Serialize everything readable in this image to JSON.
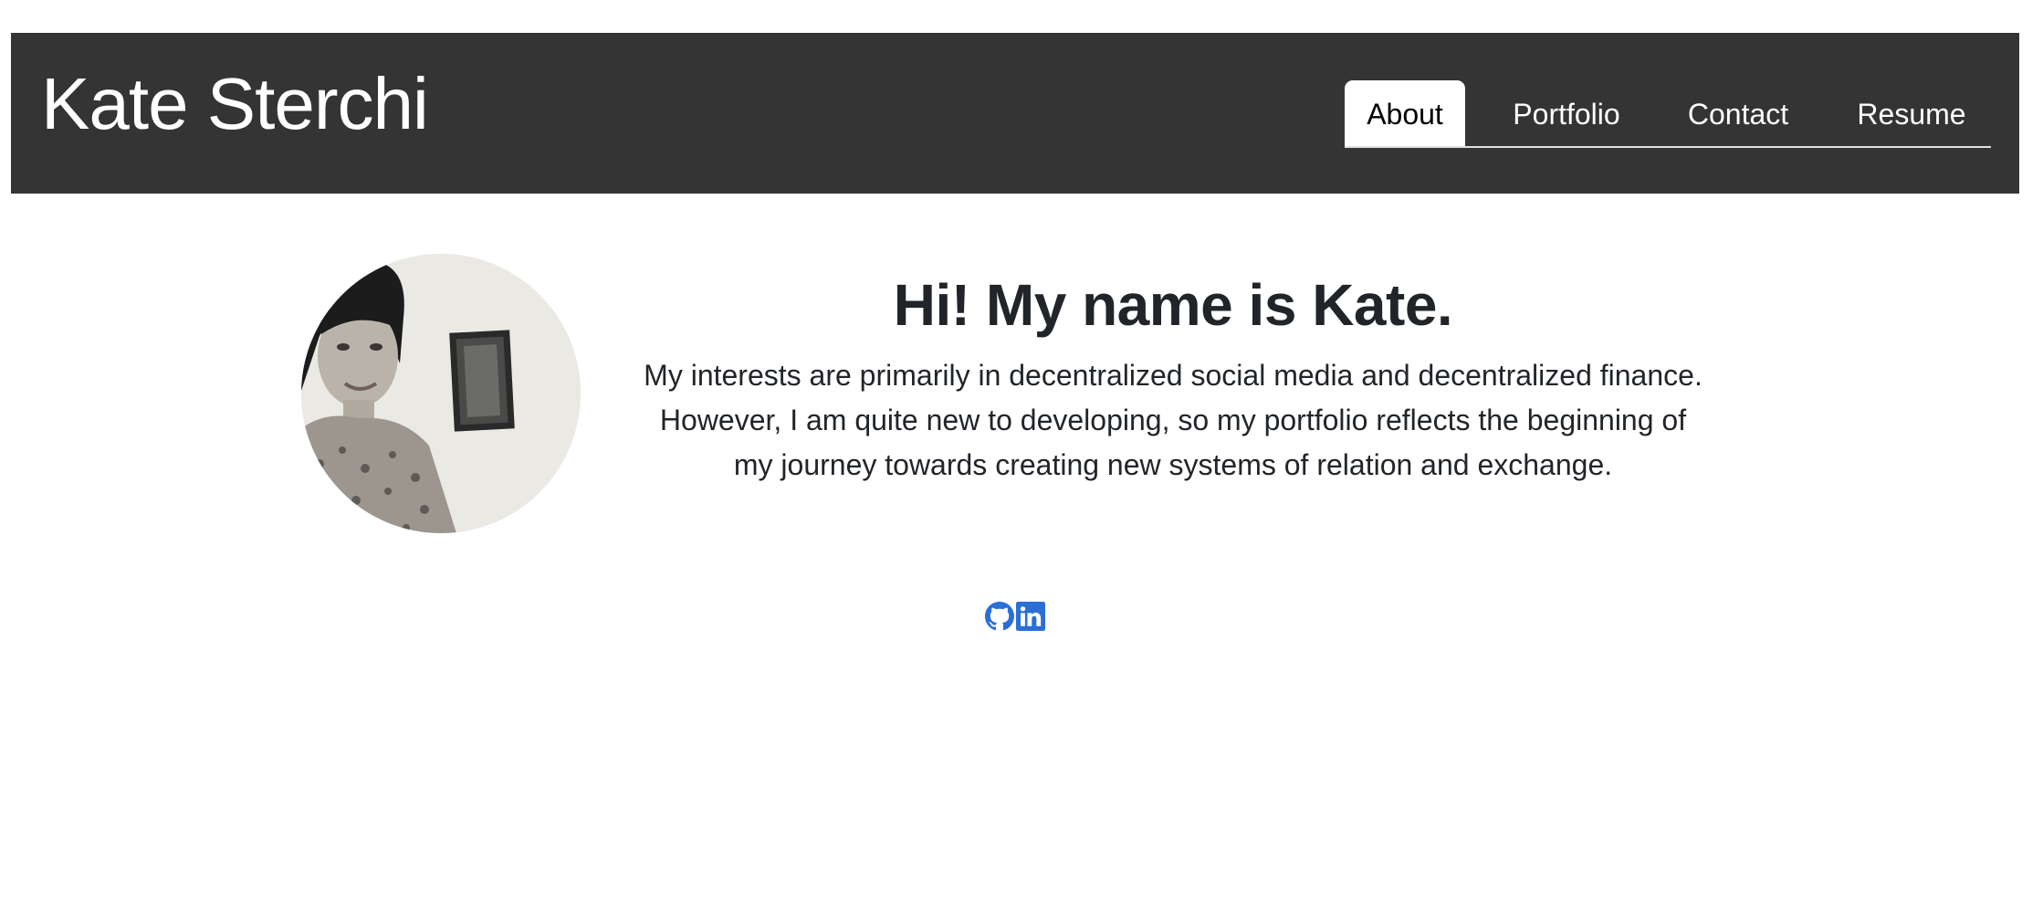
{
  "header": {
    "site_title": "Kate Sterchi",
    "background_color": "#343434"
  },
  "nav": {
    "tabs": [
      {
        "label": "About",
        "active": true
      },
      {
        "label": "Portfolio",
        "active": false
      },
      {
        "label": "Contact",
        "active": false
      },
      {
        "label": "Resume",
        "active": false
      }
    ]
  },
  "about": {
    "avatar_icon": "profile-photo",
    "heading": "Hi! My name is Kate.",
    "bio_lines": [
      "My interests are primarily in decentralized social media and decentralized finance.",
      "However, I am quite new to developing, so my portfolio reflects the beginning of",
      "my journey towards creating new systems of relation and exchange."
    ]
  },
  "socials": {
    "links": [
      {
        "icon": "github-icon"
      },
      {
        "icon": "linkedin-icon"
      }
    ],
    "color": "#2b6fd6"
  }
}
